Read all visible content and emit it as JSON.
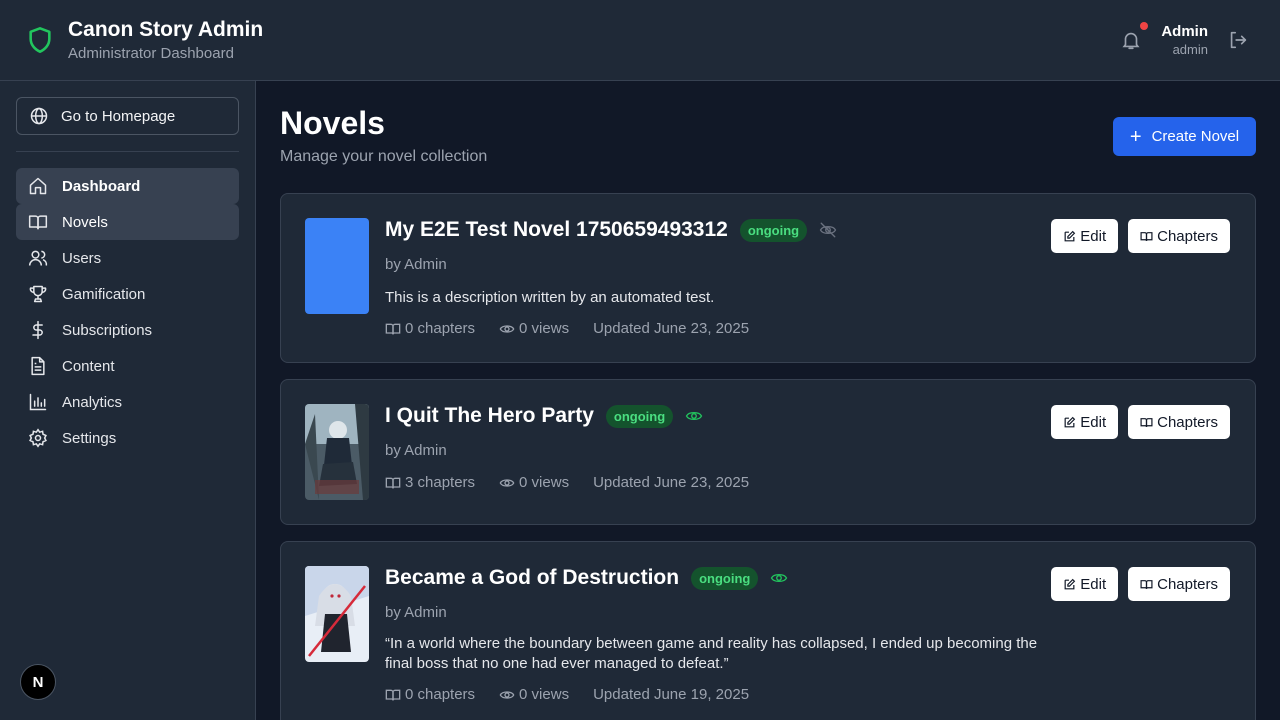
{
  "header": {
    "app_title": "Canon Story Admin",
    "app_subtitle": "Administrator Dashboard",
    "user_name": "Admin",
    "user_role": "admin",
    "notification_dot_color": "#ef4444"
  },
  "sidebar": {
    "home_button": "Go to Homepage",
    "items": [
      {
        "label": "Dashboard",
        "icon": "home-icon"
      },
      {
        "label": "Novels",
        "icon": "book-icon"
      },
      {
        "label": "Users",
        "icon": "users-icon"
      },
      {
        "label": "Gamification",
        "icon": "trophy-icon"
      },
      {
        "label": "Subscriptions",
        "icon": "dollar-icon"
      },
      {
        "label": "Content",
        "icon": "file-icon"
      },
      {
        "label": "Analytics",
        "icon": "chart-icon"
      },
      {
        "label": "Settings",
        "icon": "gear-icon"
      }
    ],
    "badge": "N"
  },
  "main": {
    "title": "Novels",
    "subtitle": "Manage your novel collection",
    "create_button": "Create Novel",
    "accent_color": "#2563eb",
    "edit_label": "Edit",
    "chapters_label": "Chapters",
    "novels": [
      {
        "title": "My E2E Test Novel 1750659493312",
        "status": "ongoing",
        "visibility": "hidden",
        "author": "by Admin",
        "description": "This is a description written by an automated test.",
        "chapters": "0 chapters",
        "views": "0 views",
        "updated": "Updated June 23, 2025"
      },
      {
        "title": "I Quit The Hero Party",
        "status": "ongoing",
        "visibility": "visible",
        "author": "by Admin",
        "description": "",
        "chapters": "3 chapters",
        "views": "0 views",
        "updated": "Updated June 23, 2025"
      },
      {
        "title": "Became a God of Destruction",
        "status": "ongoing",
        "visibility": "visible",
        "author": "by Admin",
        "description": "“In a world where the boundary between game and reality has collapsed, I ended up becoming the final boss that no one had ever managed to defeat.”",
        "chapters": "0 chapters",
        "views": "0 views",
        "updated": "Updated June 19, 2025"
      }
    ]
  }
}
